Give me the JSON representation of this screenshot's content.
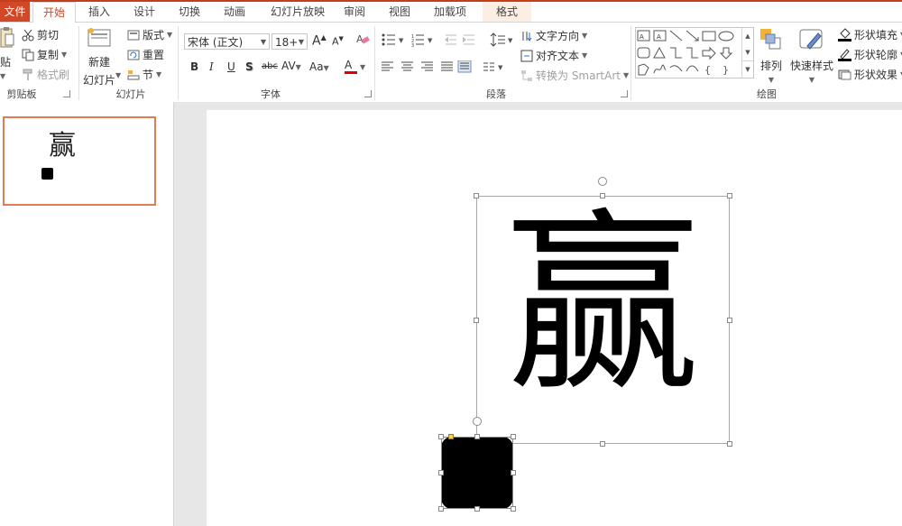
{
  "tabs": {
    "file": "文件",
    "home": "开始",
    "insert": "插入",
    "design": "设计",
    "transitions": "切换",
    "animations": "动画",
    "slideshow": "幻灯片放映",
    "review": "审阅",
    "view": "视图",
    "addins": "加载项",
    "format": "格式"
  },
  "clipboard": {
    "paste": "贴",
    "cut": "剪切",
    "copy": "复制",
    "format_painter": "格式刷",
    "label": "剪贴板"
  },
  "slides": {
    "new_slide_line1": "新建",
    "new_slide_line2": "幻灯片",
    "layout": "版式",
    "reset": "重置",
    "section": "节",
    "label": "幻灯片"
  },
  "font": {
    "name": "宋体 (正文)",
    "size": "18+",
    "grow": "A",
    "shrink": "A",
    "bold": "B",
    "italic": "I",
    "underline": "U",
    "shadow": "S",
    "strikethrough": "abc",
    "spacing": "AV",
    "case": "Aa",
    "color": "A",
    "label": "字体"
  },
  "paragraph": {
    "text_direction": "文字方向",
    "align_text": "对齐文本",
    "smartart": "转换为 SmartArt",
    "label": "段落"
  },
  "drawing": {
    "arrange": "排列",
    "quick_styles": "快速样式",
    "shape_fill": "形状填充",
    "shape_outline": "形状轮廓",
    "shape_effects": "形状效果",
    "label": "绘图"
  },
  "thumbnail": {
    "char": "赢"
  },
  "slide": {
    "char": "赢"
  },
  "colors": {
    "accent": "#d24726",
    "font_color": "#e00000"
  }
}
